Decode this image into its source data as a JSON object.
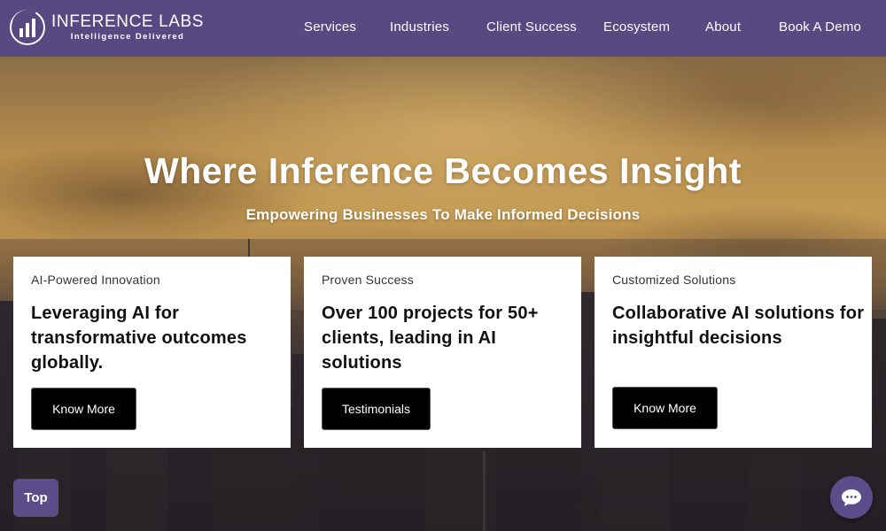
{
  "brand": {
    "name": "INFERENCE LABS",
    "tagline": "Intelligence Delivered"
  },
  "nav": {
    "items": [
      {
        "label": "Services"
      },
      {
        "label": "Industries"
      },
      {
        "label": "Client Success"
      },
      {
        "label": "Ecosystem"
      },
      {
        "label": "About"
      },
      {
        "label": "Book A Demo"
      }
    ]
  },
  "hero": {
    "title": "Where Inference Becomes Insight",
    "subtitle": "Empowering Businesses To Make Informed Decisions"
  },
  "cards": [
    {
      "label": "AI-Powered Innovation",
      "heading": "Leveraging AI for transformative outcomes globally.",
      "button": "Know More"
    },
    {
      "label": "Proven Success",
      "heading": "Over 100 projects for 50+ clients, leading in AI solutions",
      "button": "Testimonials"
    },
    {
      "label": "Customized Solutions",
      "heading": "Collaborative AI solutions for insightful decisions",
      "button": "Know More"
    }
  ],
  "floating": {
    "top_label": "Top",
    "chat_icon": "chat-bubble-icon"
  },
  "colors": {
    "nav_bg": "#574a82",
    "accent": "#5b4d8a",
    "button_bg": "#000000",
    "card_bg": "#ffffff"
  }
}
